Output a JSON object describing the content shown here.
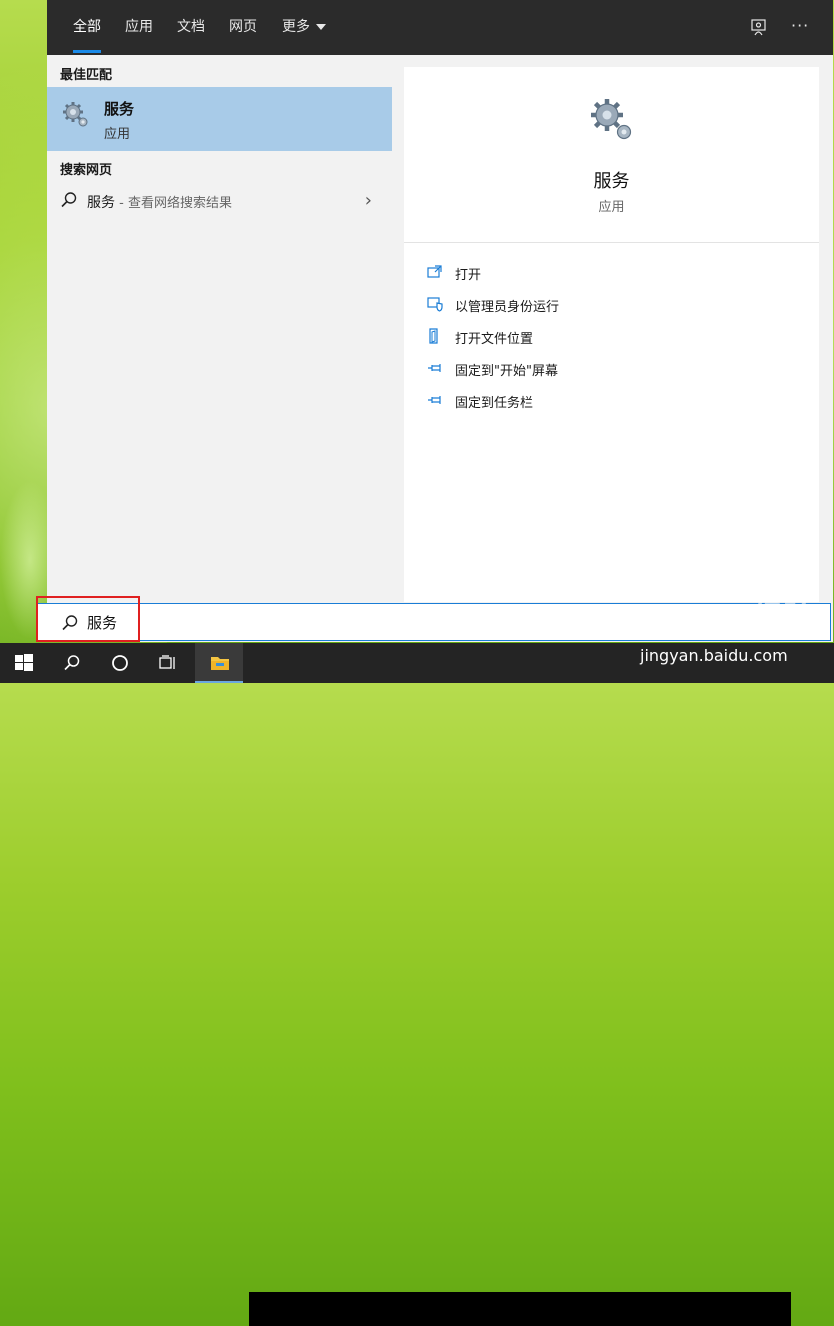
{
  "tabs": [
    {
      "label": "全部",
      "active": true
    },
    {
      "label": "应用"
    },
    {
      "label": "文档"
    },
    {
      "label": "网页"
    },
    {
      "label": "更多"
    }
  ],
  "top_icons": [
    "feedback-icon",
    "more-options-icon"
  ],
  "top_more_glyph": "···",
  "left": {
    "best_match_label": "最佳匹配",
    "best_match": {
      "title": "服务",
      "subtitle": "应用",
      "icon": "services-gear-icon"
    },
    "web_label": "搜索网页",
    "web_result": {
      "query": "服务",
      "hint": " - 查看网络搜索结果",
      "chevron": "›"
    }
  },
  "detail": {
    "title": "服务",
    "subtitle": "应用",
    "actions": [
      {
        "label": "打开",
        "icon": "open-icon"
      },
      {
        "label": "以管理员身份运行",
        "icon": "run-as-admin-icon"
      },
      {
        "label": "打开文件位置",
        "icon": "file-location-icon"
      },
      {
        "label": "固定到\"开始\"屏幕",
        "icon": "pin-icon"
      },
      {
        "label": "固定到任务栏",
        "icon": "pin-icon"
      }
    ]
  },
  "search": {
    "value": "服务"
  },
  "taskbar": [
    "windows-start-icon",
    "search-icon",
    "cortana-icon",
    "task-view-icon",
    "file-explorer-icon"
  ],
  "watermark": {
    "logo": "Baidu 经验",
    "url": "jingyan.baidu.com"
  },
  "colors": {
    "accent": "#1a8ae8",
    "selection": "#a8cbe8",
    "highlight_box": "#e02020",
    "header": "#2b2b2b",
    "taskbar": "#242424"
  }
}
